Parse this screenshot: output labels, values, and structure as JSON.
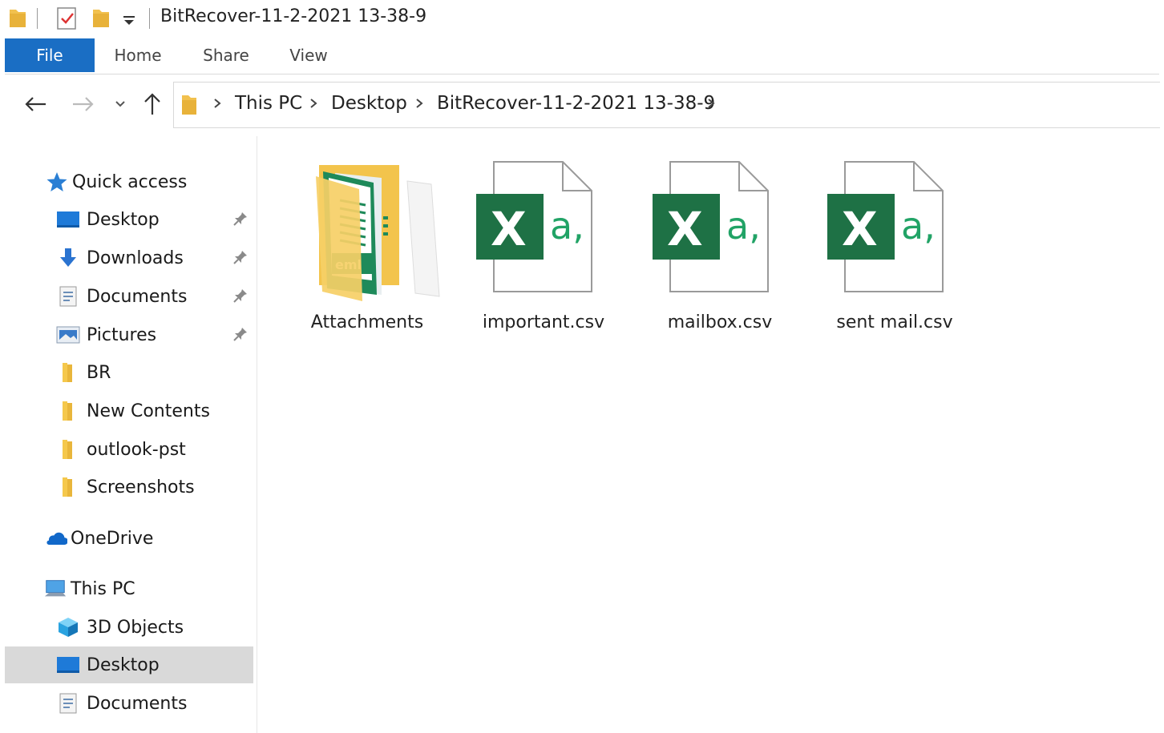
{
  "window": {
    "title": "BitRecover-11-2-2021 13-38-9"
  },
  "quick_access_toolbar": {
    "icons": [
      "folder-icon",
      "properties-check-icon",
      "new-folder-icon",
      "customize-dropdown-icon"
    ]
  },
  "ribbon": {
    "tabs": [
      {
        "label": "File",
        "active": true
      },
      {
        "label": "Home"
      },
      {
        "label": "Share"
      },
      {
        "label": "View"
      }
    ]
  },
  "address_bar": {
    "breadcrumbs": [
      "This PC",
      "Desktop",
      "BitRecover-11-2-2021 13-38-9"
    ]
  },
  "nav_pane": {
    "quick_access": {
      "label": "Quick access"
    },
    "items": [
      {
        "label": "Desktop",
        "icon": "desktop-icon",
        "pinned": true
      },
      {
        "label": "Downloads",
        "icon": "downloads-icon",
        "pinned": true
      },
      {
        "label": "Documents",
        "icon": "documents-icon",
        "pinned": true
      },
      {
        "label": "Pictures",
        "icon": "pictures-icon",
        "pinned": true
      },
      {
        "label": "BR",
        "icon": "folder-icon"
      },
      {
        "label": "New Contents",
        "icon": "folder-icon"
      },
      {
        "label": "outlook-pst",
        "icon": "folder-icon"
      },
      {
        "label": "Screenshots",
        "icon": "folder-icon"
      }
    ],
    "onedrive": {
      "label": "OneDrive"
    },
    "this_pc": {
      "label": "This PC",
      "items": [
        {
          "label": "3D Objects",
          "icon": "3d-objects-icon"
        },
        {
          "label": "Desktop",
          "icon": "desktop-icon",
          "selected": true
        },
        {
          "label": "Documents",
          "icon": "documents-icon"
        }
      ]
    }
  },
  "content": {
    "files": [
      {
        "name": "Attachments",
        "type": "folder"
      },
      {
        "name": "important.csv",
        "type": "csv"
      },
      {
        "name": "mailbox.csv",
        "type": "csv"
      },
      {
        "name": "sent mail.csv",
        "type": "csv"
      }
    ],
    "csv_badge_letter": "X",
    "csv_badge_text": "a,",
    "attachment_tag": "eml"
  },
  "colors": {
    "file_tab": "#1a6ec4",
    "excel_green": "#1e7145",
    "folder_yellow": "#f5c84c",
    "selected_bg": "#d9d9d9"
  }
}
